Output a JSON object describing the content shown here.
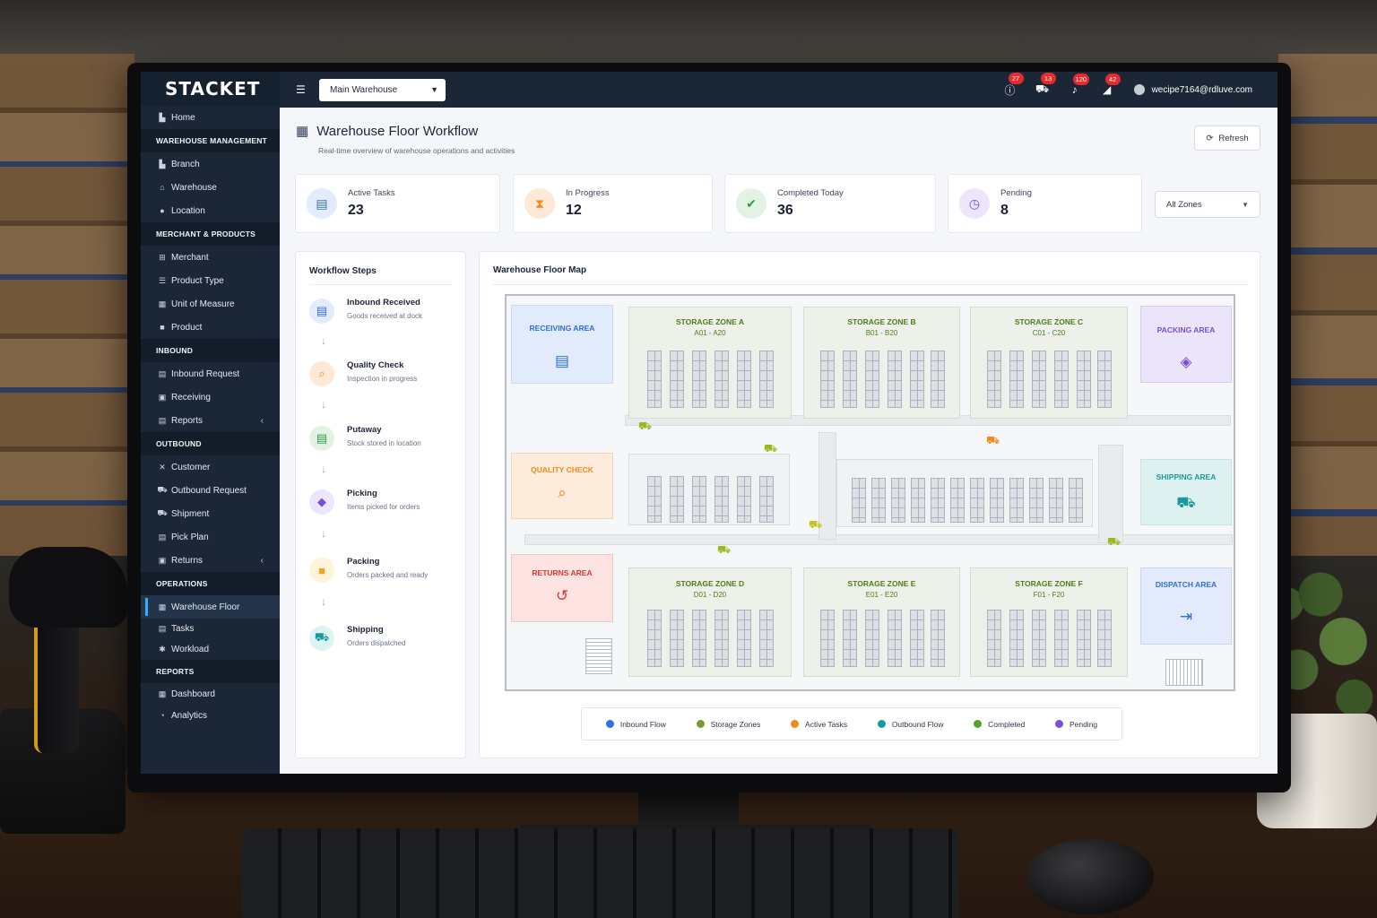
{
  "brand": "STACKET",
  "topbar": {
    "warehouse_select": "Main Warehouse",
    "notifications": [
      {
        "icon": "alert-icon",
        "count": "27"
      },
      {
        "icon": "cart-icon",
        "count": "13"
      },
      {
        "icon": "bell-icon",
        "count": "120"
      },
      {
        "icon": "megaphone-icon",
        "count": "42"
      }
    ],
    "user_email": "wecipe7164@rdluve.com"
  },
  "sidebar": {
    "home": "Home",
    "groups": [
      {
        "title": "WAREHOUSE MANAGEMENT",
        "items": [
          "Branch",
          "Warehouse",
          "Location"
        ]
      },
      {
        "title": "MERCHANT & PRODUCTS",
        "items": [
          "Merchant",
          "Product Type",
          "Unit of Measure",
          "Product"
        ]
      },
      {
        "title": "INBOUND",
        "items": [
          "Inbound Request",
          "Receiving",
          "Reports"
        ]
      },
      {
        "title": "OUTBOUND",
        "items": [
          "Customer",
          "Outbound Request",
          "Shipment",
          "Pick Plan",
          "Returns"
        ]
      },
      {
        "title": "OPERATIONS",
        "items": [
          "Warehouse Floor",
          "Tasks",
          "Workload"
        ]
      },
      {
        "title": "REPORTS",
        "items": [
          "Dashboard",
          "Analytics"
        ]
      }
    ]
  },
  "page": {
    "title": "Warehouse Floor Workflow",
    "subtitle": "Real-time overview of warehouse operations and activities",
    "refresh_label": "Refresh",
    "zones_select": "All Zones"
  },
  "stats": [
    {
      "label": "Active Tasks",
      "value": "23",
      "color": "#2f6fe0"
    },
    {
      "label": "In Progress",
      "value": "12",
      "color": "#f08a1c"
    },
    {
      "label": "Completed Today",
      "value": "36",
      "color": "#2f9b45"
    },
    {
      "label": "Pending",
      "value": "8",
      "color": "#7b4fd6"
    }
  ],
  "workflow": {
    "title": "Workflow Steps",
    "steps": [
      {
        "title": "Inbound Received",
        "desc": "Goods received at dock"
      },
      {
        "title": "Quality Check",
        "desc": "Inspection in progress"
      },
      {
        "title": "Putaway",
        "desc": "Stock stored in location"
      },
      {
        "title": "Picking",
        "desc": "Items picked for orders"
      },
      {
        "title": "Packing",
        "desc": "Orders packed and ready"
      },
      {
        "title": "Shipping",
        "desc": "Orders dispatched"
      }
    ]
  },
  "map": {
    "title": "Warehouse Floor Map",
    "areas": {
      "receiving": "RECEIVING AREA",
      "quality": "QUALITY CHECK",
      "returns": "RETURNS AREA",
      "packing": "PACKING AREA",
      "shipping": "SHIPPING AREA",
      "dispatch": "DISPATCH AREA"
    },
    "storage_zones": [
      {
        "name": "STORAGE ZONE A",
        "range": "A01 - A20"
      },
      {
        "name": "STORAGE ZONE B",
        "range": "B01 - B20"
      },
      {
        "name": "STORAGE ZONE C",
        "range": "C01 - C20"
      },
      {
        "name": "STORAGE ZONE D",
        "range": "D01 - D20"
      },
      {
        "name": "STORAGE ZONE E",
        "range": "E01 - E20"
      },
      {
        "name": "STORAGE ZONE F",
        "range": "F01 - F20"
      }
    ],
    "legend": [
      {
        "label": "Inbound Flow",
        "color": "#2f6fe0"
      },
      {
        "label": "Storage Zones",
        "color": "#7a9a2a"
      },
      {
        "label": "Active Tasks",
        "color": "#f08a1c"
      },
      {
        "label": "Outbound Flow",
        "color": "#1a9a9a"
      },
      {
        "label": "Completed",
        "color": "#5aa02c"
      },
      {
        "label": "Pending",
        "color": "#7b4fd6"
      }
    ]
  }
}
